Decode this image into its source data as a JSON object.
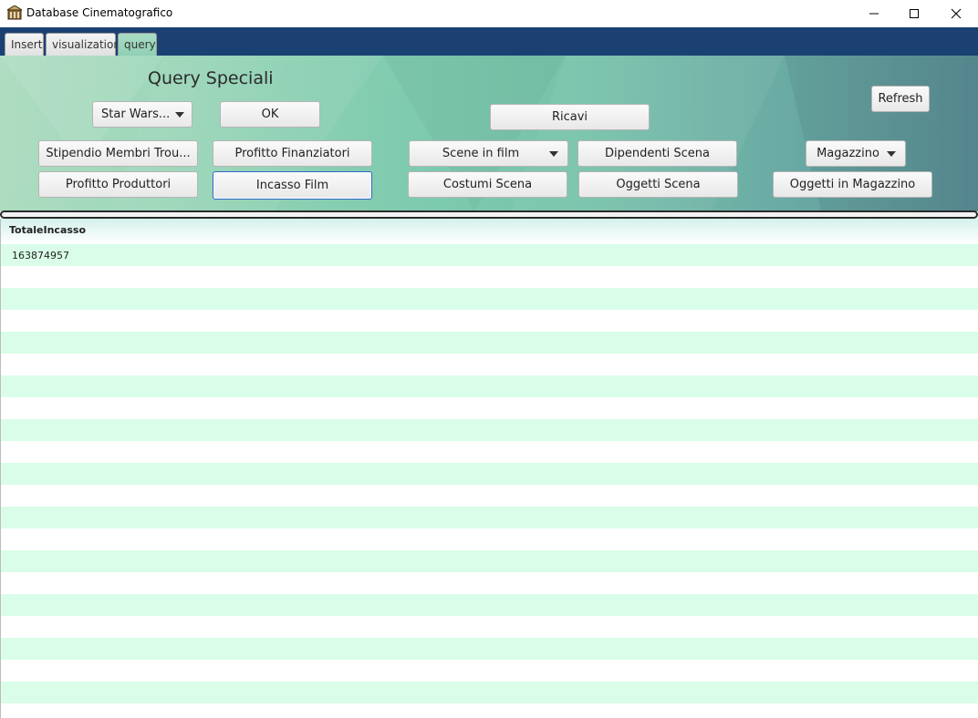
{
  "window": {
    "title": "Database Cinematografico",
    "controls": {
      "minimize": "minimize-icon",
      "maximize": "maximize-icon",
      "close": "close-icon"
    }
  },
  "tabs": [
    {
      "label": "Insert",
      "selected": false
    },
    {
      "label": "visualization",
      "selected": false
    },
    {
      "label": "query",
      "selected": true
    }
  ],
  "panel": {
    "title": "Query Speciali",
    "film_combo": "Star Wars...",
    "ok_label": "OK",
    "ricavi_label": "Ricavi",
    "refresh_label": "Refresh",
    "stipendio_label": "Stipendio Membri Trou...",
    "profitto_finanziatori_label": "Profitto Finanziatori",
    "scene_combo": "Scene in film",
    "dipendenti_label": "Dipendenti Scena",
    "magazzino_combo": "Magazzino",
    "profitto_produttori_label": "Profitto Produttori",
    "incasso_label": "Incasso Film",
    "costumi_label": "Costumi Scena",
    "oggetti_scena_label": "Oggetti Scena",
    "oggetti_magazzino_label": "Oggetti in Magazzino"
  },
  "table": {
    "columns": [
      "TotaleIncasso"
    ],
    "rows": [
      [
        "163874957"
      ]
    ]
  },
  "colors": {
    "tabbar": "#1b4172",
    "row_alt": "#d9fde8",
    "focus": "#2f67c7"
  }
}
